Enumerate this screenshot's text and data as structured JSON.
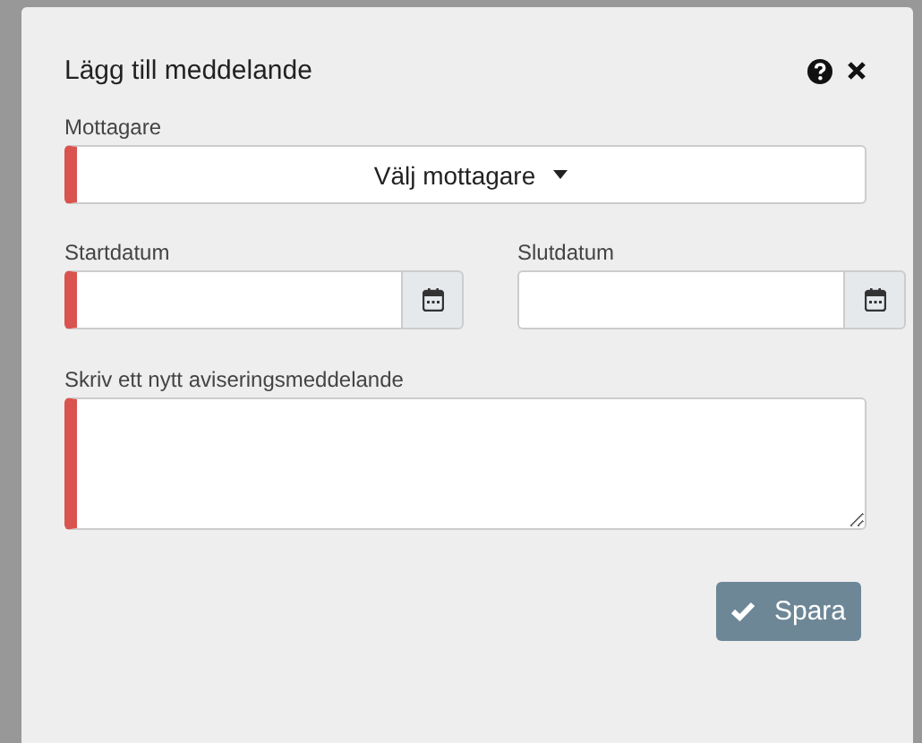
{
  "dialog": {
    "title": "Lägg till meddelande"
  },
  "recipient": {
    "label": "Mottagare",
    "value": "Välj mottagare",
    "required": true
  },
  "start_date": {
    "label": "Startdatum",
    "required": true
  },
  "end_date": {
    "label": "Slutdatum",
    "required": false
  },
  "message": {
    "label": "Skriv ett nytt aviseringsmeddelande",
    "required": true
  },
  "save_button": {
    "label": "Spara"
  }
}
